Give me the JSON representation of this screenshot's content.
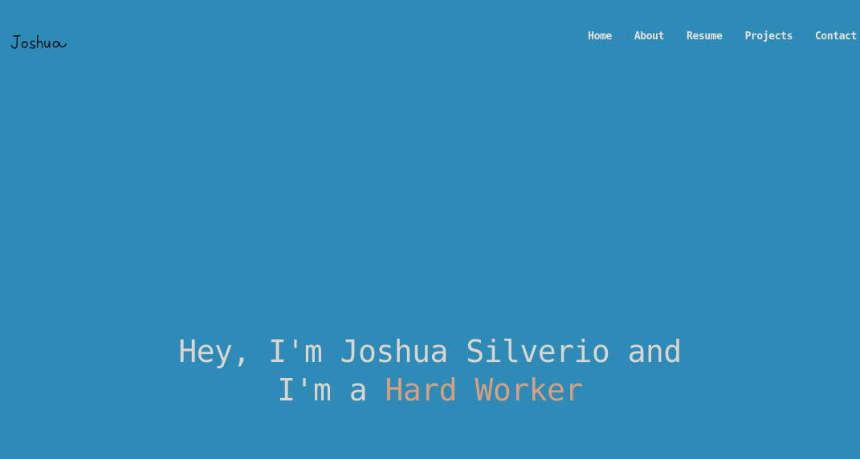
{
  "brand": {
    "logo_text": "Joshua"
  },
  "nav": {
    "items": [
      {
        "label": "Home"
      },
      {
        "label": "About"
      },
      {
        "label": "Resume"
      },
      {
        "label": "Projects"
      },
      {
        "label": "Contact"
      }
    ]
  },
  "hero": {
    "line1": "Hey, I'm Joshua Silverio and",
    "line2_prefix": "I'm a ",
    "line2_highlight": "Hard Worker"
  },
  "colors": {
    "background": "#2e8ab6",
    "nav_text": "#e8e2da",
    "hero_text": "#dad5cf",
    "highlight": "#d79f7f",
    "logo_ink": "#111111"
  }
}
